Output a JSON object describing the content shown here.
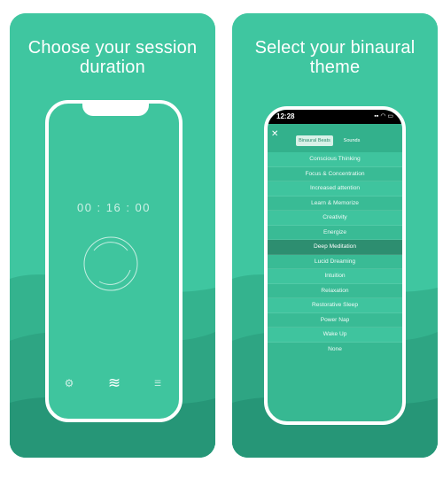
{
  "left_panel": {
    "headline_line1": "Choose your session",
    "headline_line2": "duration",
    "timer": "00 : 16 : 00",
    "tabs": [
      {
        "icon": "gear-icon",
        "glyph": "⚙"
      },
      {
        "icon": "waves-icon",
        "glyph": "≋"
      },
      {
        "icon": "sliders-icon",
        "glyph": "☰"
      }
    ]
  },
  "right_panel": {
    "headline_line1": "Select your binaural",
    "headline_line2": "theme",
    "status_time": "12:28",
    "status_icons": "▪▪ ◠ ▭",
    "close_glyph": "✕",
    "segments": [
      "Binaural Beats",
      "Sounds"
    ],
    "themes": [
      "Conscious Thinking",
      "Focus & Concentration",
      "Increased attention",
      "Learn & Memorize",
      "Creativity",
      "Energize",
      "Deep Meditation",
      "Lucid Dreaming",
      "Intuition",
      "Relaxation",
      "Restorative Sleep",
      "Power Nap",
      "Wake Up",
      "None"
    ],
    "selected_theme": "Deep Meditation"
  },
  "colors": {
    "panel_base": "#3cc39c",
    "panel_dark": "#2a9a78",
    "selected_row": "#2d8e70",
    "white": "#ffffff"
  }
}
